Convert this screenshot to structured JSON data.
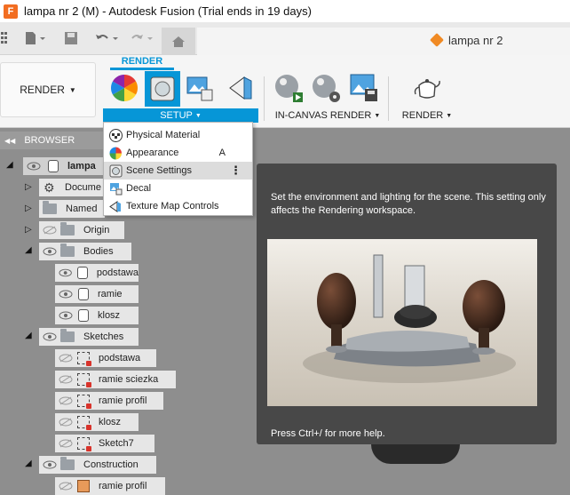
{
  "window": {
    "title": "lampa nr 2 (M) - Autodesk Fusion (Trial ends in 19 days)",
    "app_icon_letter": "F"
  },
  "quick_access": {
    "document_tab_label": "lampa nr 2"
  },
  "ribbon": {
    "workspace_label": "RENDER",
    "active_tab": "RENDER",
    "groups": {
      "setup": "SETUP",
      "in_canvas_render": "IN-CANVAS RENDER",
      "render": "RENDER"
    }
  },
  "setup_menu": {
    "items": [
      {
        "label": "Physical Material",
        "shortcut": ""
      },
      {
        "label": "Appearance",
        "shortcut": "A"
      },
      {
        "label": "Scene Settings",
        "shortcut": "",
        "active": true
      },
      {
        "label": "Decal",
        "shortcut": ""
      },
      {
        "label": "Texture Map Controls",
        "shortcut": ""
      }
    ]
  },
  "browser": {
    "header": "BROWSER",
    "root_label": "lampa",
    "items": [
      {
        "label": "Docume"
      },
      {
        "label": "Named"
      },
      {
        "label": "Origin"
      },
      {
        "label": "Bodies"
      },
      {
        "label": "podstawa"
      },
      {
        "label": "ramie"
      },
      {
        "label": "klosz"
      },
      {
        "label": "Sketches"
      },
      {
        "label": "podstawa"
      },
      {
        "label": "ramie sciezka"
      },
      {
        "label": "ramie profil"
      },
      {
        "label": "klosz"
      },
      {
        "label": "Sketch7"
      },
      {
        "label": "Construction"
      },
      {
        "label": "ramie profil"
      }
    ]
  },
  "tooltip": {
    "description": "Set the environment and lighting for the scene. This setting only affects the Rendering workspace.",
    "help": "Press Ctrl+/ for more help."
  },
  "colors": {
    "accent": "#0696d7",
    "tooltip_bg": "#484848",
    "canvas_bg": "#8e8e8e"
  }
}
